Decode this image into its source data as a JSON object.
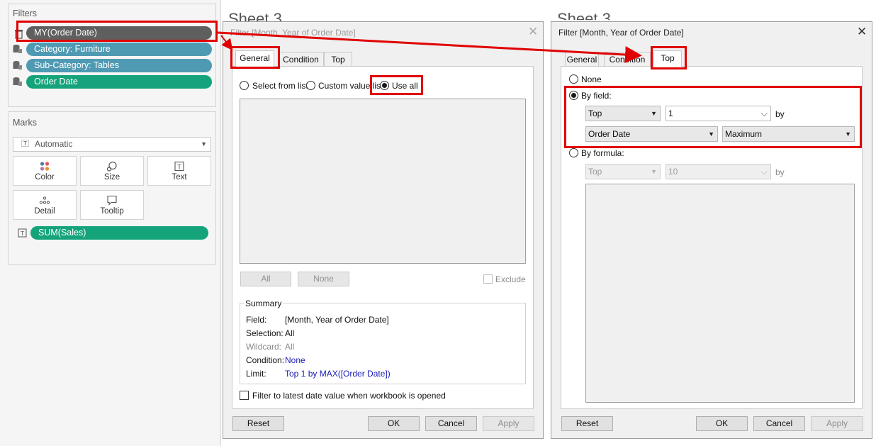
{
  "filters": {
    "title": "Filters",
    "pills": [
      {
        "label": "MY(Order Date)"
      },
      {
        "label": "Category: Furniture"
      },
      {
        "label": "Sub-Category: Tables"
      },
      {
        "label": "Order Date"
      }
    ]
  },
  "marks": {
    "title": "Marks",
    "type": "Automatic",
    "buttons": [
      {
        "label": "Color",
        "icon": "color-dots-icon"
      },
      {
        "label": "Size",
        "icon": "size-icon"
      },
      {
        "label": "Text",
        "icon": "text-icon"
      },
      {
        "label": "Detail",
        "icon": "detail-icon"
      },
      {
        "label": "Tooltip",
        "icon": "tooltip-icon"
      }
    ],
    "field_pill": "SUM(Sales)"
  },
  "sheet_title": "Sheet 3",
  "dialog_general": {
    "title": "Filter [Month, Year of Order Date]",
    "tabs": [
      "General",
      "Condition",
      "Top"
    ],
    "options": [
      "Select from list",
      "Custom value list",
      "Use all"
    ],
    "btn_all": "All",
    "btn_none": "None",
    "exclude": "Exclude",
    "summary": {
      "title": "Summary",
      "rows": [
        {
          "label": "Field:",
          "value": "[Month, Year of Order Date]"
        },
        {
          "label": "Selection:",
          "value": "All"
        },
        {
          "label": "Wildcard:",
          "value": "All"
        },
        {
          "label": "Condition:",
          "value": "None"
        },
        {
          "label": "Limit:",
          "value": "Top 1 by MAX([Order Date])"
        }
      ]
    },
    "latest_date_label": "Filter to latest date value when workbook is opened",
    "reset": "Reset",
    "ok": "OK",
    "cancel": "Cancel",
    "apply": "Apply"
  },
  "dialog_top": {
    "title": "Filter [Month, Year of Order Date]",
    "tabs": [
      "General",
      "Condition",
      "Top"
    ],
    "none_label": "None",
    "by_field_label": "By field:",
    "by_formula_label": "By formula:",
    "field_row1": {
      "direction": "Top",
      "count": "1",
      "by": "by"
    },
    "field_row2": {
      "field": "Order Date",
      "aggregation": "Maximum"
    },
    "formula_row": {
      "direction": "Top",
      "count": "10",
      "by": "by"
    },
    "reset": "Reset",
    "ok": "OK",
    "cancel": "Cancel",
    "apply": "Apply"
  },
  "colors": {
    "annotation_red": "#e00000",
    "pill_gray": "#5f5f5f",
    "pill_blue": "#4f9ab3",
    "pill_green": "#14a37a"
  }
}
